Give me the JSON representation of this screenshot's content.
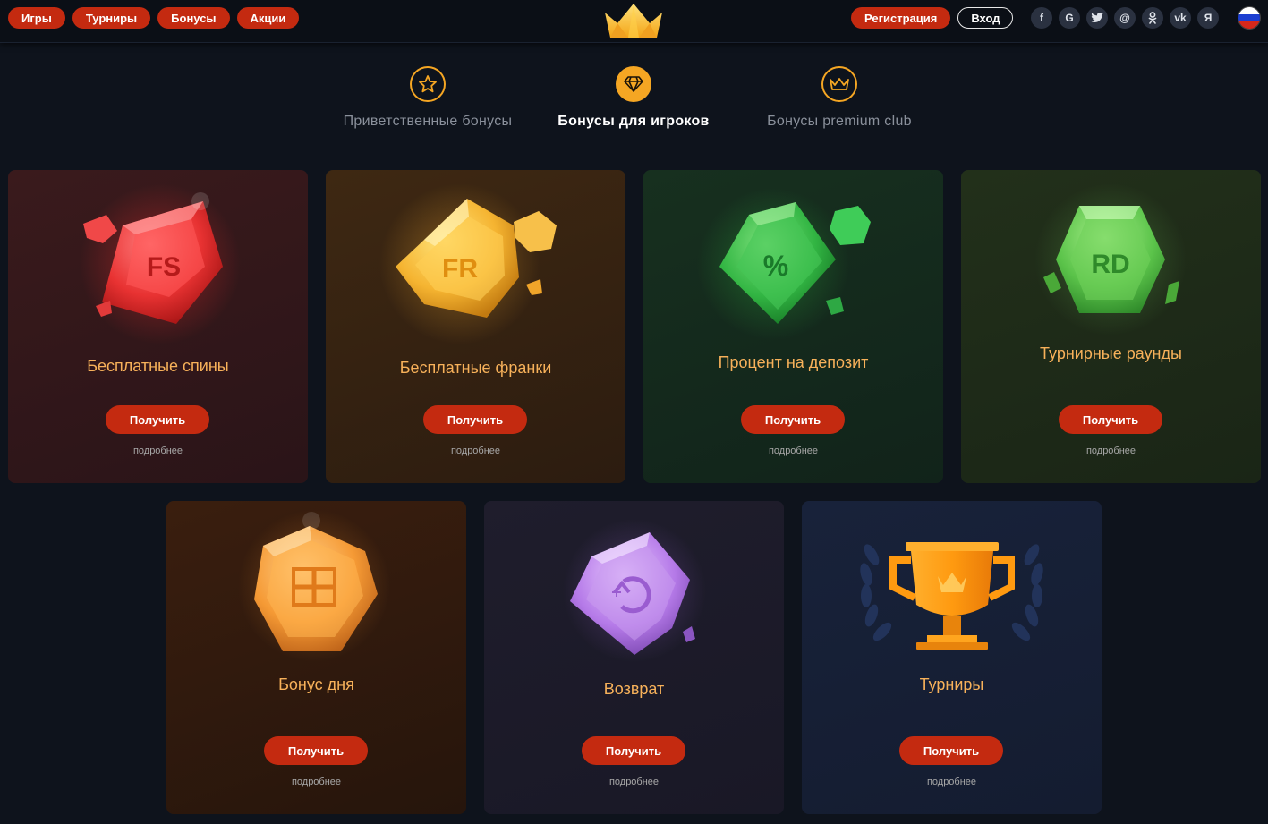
{
  "header": {
    "nav": [
      "Игры",
      "Турниры",
      "Бонусы",
      "Акции"
    ],
    "register_label": "Регистрация",
    "login_label": "Вход",
    "socials": [
      {
        "name": "facebook-icon",
        "glyph": "f"
      },
      {
        "name": "google-icon",
        "glyph": "G"
      },
      {
        "name": "twitter-icon",
        "glyph": "t"
      },
      {
        "name": "mail-icon",
        "glyph": "@"
      },
      {
        "name": "odnoklassniki-icon",
        "glyph": "ok"
      },
      {
        "name": "vk-icon",
        "glyph": "vk"
      },
      {
        "name": "yandex-icon",
        "glyph": "Я"
      }
    ],
    "language_flag": "russia-flag-icon"
  },
  "tabs": [
    {
      "label": "Приветственные бонусы",
      "icon": "star-icon",
      "active": false
    },
    {
      "label": "Бонусы для игроков",
      "icon": "diamond-icon",
      "active": true
    },
    {
      "label": "Бонусы premium club",
      "icon": "crown-icon",
      "active": false
    }
  ],
  "cards": [
    {
      "title": "Бесплатные спины",
      "gem_text": "FS",
      "button": "Получить",
      "more": "подробнее"
    },
    {
      "title": "Бесплатные франки",
      "gem_text": "FR",
      "button": "Получить",
      "more": "подробнее"
    },
    {
      "title": "Процент на депозит",
      "gem_text": "%",
      "button": "Получить",
      "more": "подробнее"
    },
    {
      "title": "Турнирные раунды",
      "gem_text": "RD",
      "button": "Получить",
      "more": "подробнее"
    },
    {
      "title": "Бонус дня",
      "gem_text": "",
      "button": "Получить",
      "more": "подробнее"
    },
    {
      "title": "Возврат",
      "gem_text": "",
      "button": "Получить",
      "more": "подробнее"
    },
    {
      "title": "Турниры",
      "gem_text": "",
      "button": "Получить",
      "more": "подробнее"
    }
  ],
  "colors": {
    "accent": "#c42a10",
    "gold": "#f5a623",
    "card_title": "#f7b15a",
    "background": "#0e131c"
  }
}
